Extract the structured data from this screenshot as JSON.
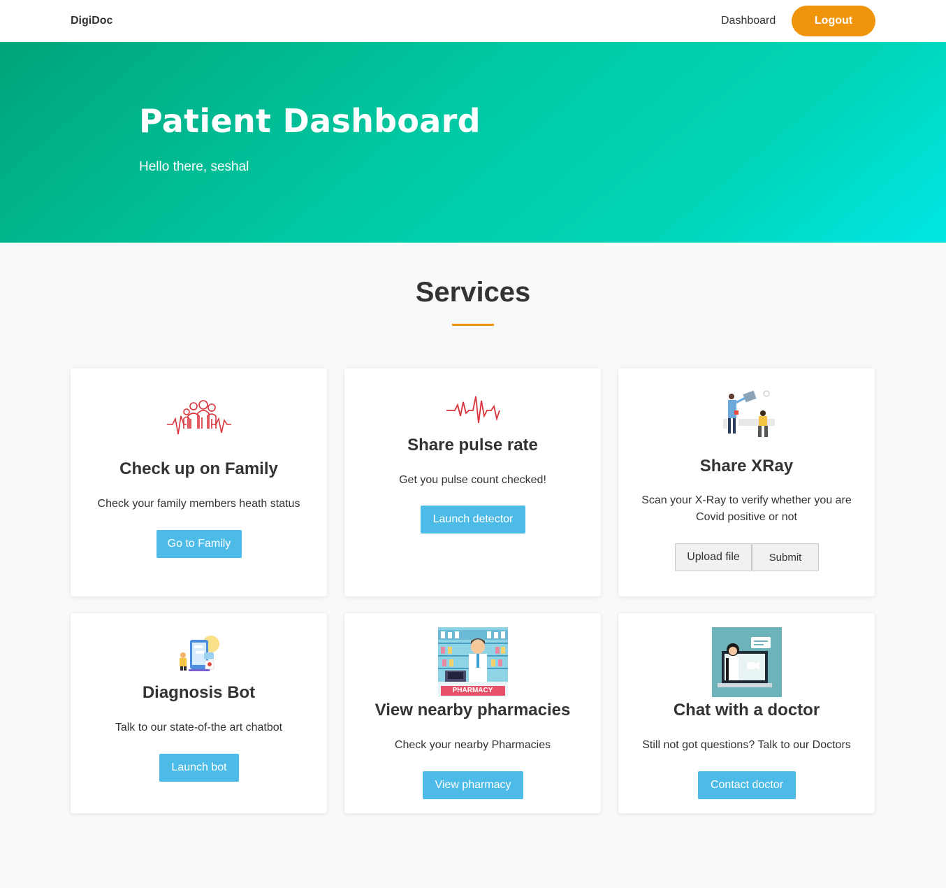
{
  "navbar": {
    "brand": "DigiDoc",
    "dashboard_link": "Dashboard",
    "logout_label": "Logout"
  },
  "hero": {
    "title": "Patient Dashboard",
    "subtitle": "Hello there, seshal"
  },
  "services": {
    "title": "Services",
    "cards": [
      {
        "icon": "family-heartbeat-icon",
        "title": "Check up on Family",
        "text": "Check your family members heath status",
        "button": "Go to Family"
      },
      {
        "icon": "pulse-icon",
        "title": "Share pulse rate",
        "text": "Get you pulse count checked!",
        "button": "Launch detector"
      },
      {
        "icon": "xray-doctor-icon",
        "title": "Share XRay",
        "text": "Scan your X-Ray to verify whether you are Covid positive or not",
        "upload_label": "Upload file",
        "submit_label": "Submit"
      },
      {
        "icon": "chatbot-icon",
        "title": "Diagnosis Bot",
        "text": "Talk to our state-of-the art chatbot",
        "button": "Launch bot"
      },
      {
        "icon": "pharmacist-icon",
        "image_label": "PHARMACY",
        "title": "View nearby pharmacies",
        "text": "Check your nearby Pharmacies",
        "button": "View pharmacy"
      },
      {
        "icon": "video-call-doctor-icon",
        "title": "Chat with a doctor",
        "text": "Still not got questions? Talk to our Doctors",
        "button": "Contact doctor"
      }
    ]
  },
  "colors": {
    "accent": "#f0950b",
    "button_blue": "#4dbbe8",
    "hero_gradient_start": "#00a47a",
    "hero_gradient_end": "#00e6e4"
  }
}
